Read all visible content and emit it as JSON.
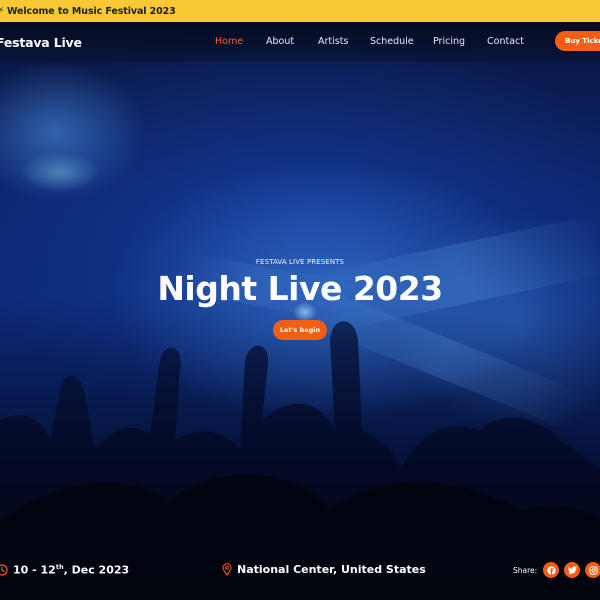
{
  "topbar": {
    "icon": "bolt-icon",
    "welcome_text": "Welcome to Music Festival 2023",
    "background_color": "#F8C935"
  },
  "nav": {
    "brand": "Festava Live",
    "links": [
      {
        "label": "Home",
        "active": true
      },
      {
        "label": "About",
        "active": false
      },
      {
        "label": "Artists",
        "active": false
      },
      {
        "label": "Schedule",
        "active": false
      },
      {
        "label": "Pricing",
        "active": false
      },
      {
        "label": "Contact",
        "active": false
      }
    ],
    "buy_ticket_label": "Buy Ticket"
  },
  "hero": {
    "presents": "FESTAVA LIVE PRESENTS",
    "title": "Night Live 2023",
    "cta_label": "Let's begin"
  },
  "event_info": {
    "date_icon": "clock-icon",
    "date_prefix": "10 - 12",
    "date_sup": "th",
    "date_suffix": ", Dec 2023",
    "location_icon": "map-pin-icon",
    "location": "National Center, United States",
    "share_label": "Share:",
    "social": [
      {
        "name": "facebook",
        "icon": "facebook-icon"
      },
      {
        "name": "twitter",
        "icon": "twitter-icon"
      },
      {
        "name": "instagram",
        "icon": "instagram-icon"
      }
    ]
  },
  "colors": {
    "accent": "#F25E14",
    "active_link": "#F0622A",
    "topbar": "#F8C935",
    "dark_bg": "#050A1F"
  }
}
